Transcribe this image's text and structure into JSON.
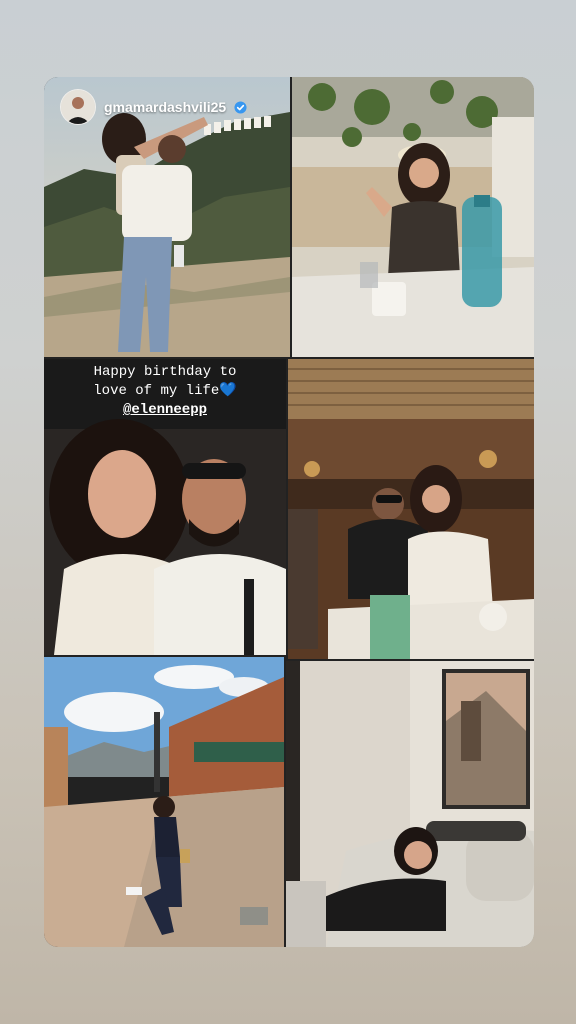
{
  "story": {
    "username": "gmamardashvili25",
    "verified": true,
    "caption": {
      "line1": "Happy birthday to",
      "line2": "love of my life",
      "heart": "💙",
      "mention": "@elenneepp"
    }
  },
  "photos": [
    {
      "label": "Hollywood sign hike photo",
      "sign_text": "HOLLYWOOD"
    },
    {
      "label": "cafe photo with hat"
    },
    {
      "label": "car selfie couple"
    },
    {
      "label": "restaurant bar couple photo"
    },
    {
      "label": "outdoor shopping street pose"
    },
    {
      "label": "resting on couch photo"
    }
  ],
  "colors": {
    "background": "#c9cfd3",
    "heart": "#3d8ee8",
    "verified": "#3897f0"
  }
}
